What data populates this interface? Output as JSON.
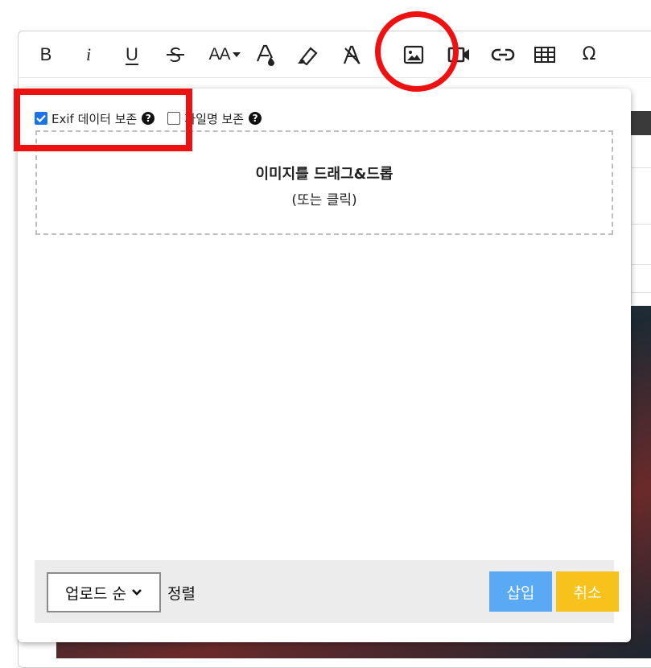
{
  "toolbar": {
    "bold_label": "B",
    "italic_label": "i",
    "underline_label": "U",
    "font_size_label": "AA",
    "buttons": [
      {
        "name": "bold",
        "icon": "bold-icon"
      },
      {
        "name": "italic",
        "icon": "italic-icon"
      },
      {
        "name": "underline",
        "icon": "underline-icon"
      },
      {
        "name": "strikethrough",
        "icon": "strikethrough-icon"
      },
      {
        "name": "font-size",
        "icon": "font-size-icon"
      },
      {
        "name": "font-color",
        "icon": "font-color-icon"
      },
      {
        "name": "highlight",
        "icon": "highlighter-icon"
      },
      {
        "name": "clear-format",
        "icon": "clear-format-icon"
      },
      {
        "name": "image",
        "icon": "image-icon"
      },
      {
        "name": "video",
        "icon": "video-icon"
      },
      {
        "name": "link",
        "icon": "link-icon"
      },
      {
        "name": "table",
        "icon": "table-icon"
      },
      {
        "name": "special-char",
        "icon": "omega-icon"
      }
    ],
    "omega_label": "Ω"
  },
  "modal": {
    "exif_label": "Exif 데이터 보존",
    "exif_checked": true,
    "filename_label": "파일명 보존",
    "filename_checked": false,
    "help_glyph": "?",
    "dropzone_title": "이미지를 드래그&드롭",
    "dropzone_sub": "(또는 클릭)",
    "sort_value": "업로드 순",
    "sort_label": "정렬",
    "insert_label": "삽입",
    "cancel_label": "취소"
  },
  "colors": {
    "checkbox_accent": "#1a73e8",
    "insert_button": "#5aa9f5",
    "cancel_button": "#f7c21b",
    "annotation": "#ee1111"
  }
}
